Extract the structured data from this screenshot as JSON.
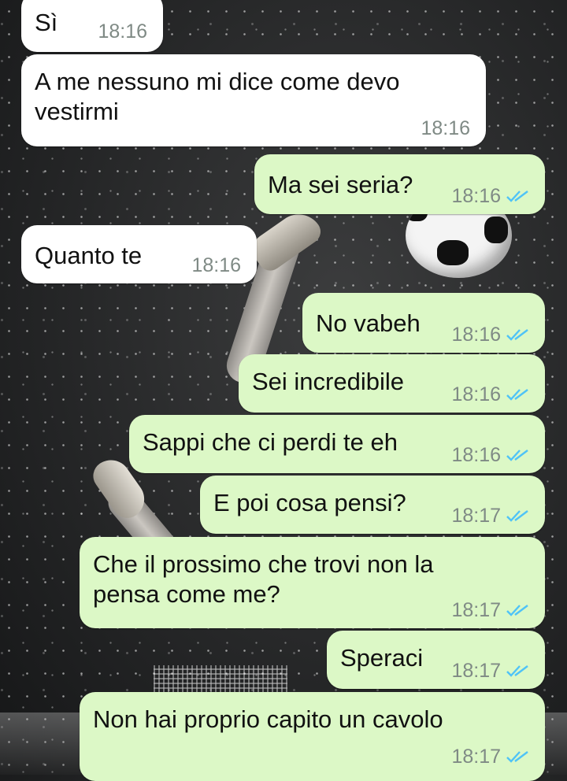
{
  "messages": [
    {
      "text": "Sì",
      "time": "18:16",
      "direction": "incoming"
    },
    {
      "text": "A me nessuno mi dice come devo\nvestirmi",
      "time": "18:16",
      "direction": "incoming"
    },
    {
      "text": "Ma sei seria?",
      "time": "18:16",
      "direction": "outgoing",
      "status": "read"
    },
    {
      "text": "Quanto te",
      "time": "18:16",
      "direction": "incoming"
    },
    {
      "text": "No vabeh",
      "time": "18:16",
      "direction": "outgoing",
      "status": "read"
    },
    {
      "text": "Sei incredibile",
      "time": "18:16",
      "direction": "outgoing",
      "status": "read"
    },
    {
      "text": "Sappi che ci perdi te eh",
      "time": "18:16",
      "direction": "outgoing",
      "status": "read"
    },
    {
      "text": "E poi cosa pensi?",
      "time": "18:17",
      "direction": "outgoing",
      "status": "read"
    },
    {
      "text": "Che il prossimo che trovi non la\npensa come me?",
      "time": "18:17",
      "direction": "outgoing",
      "status": "read"
    },
    {
      "text": "Speraci",
      "time": "18:17",
      "direction": "outgoing",
      "status": "read"
    },
    {
      "text": "Non hai proprio capito un cavolo",
      "time": "18:17",
      "direction": "outgoing",
      "status": "read"
    }
  ],
  "colors": {
    "incoming_bubble": "#ffffff",
    "outgoing_bubble": "#dcf8c6",
    "read_ticks": "#4fc3f7",
    "timestamp": "#7f8a85"
  },
  "wallpaper": "night football stadium with snow"
}
